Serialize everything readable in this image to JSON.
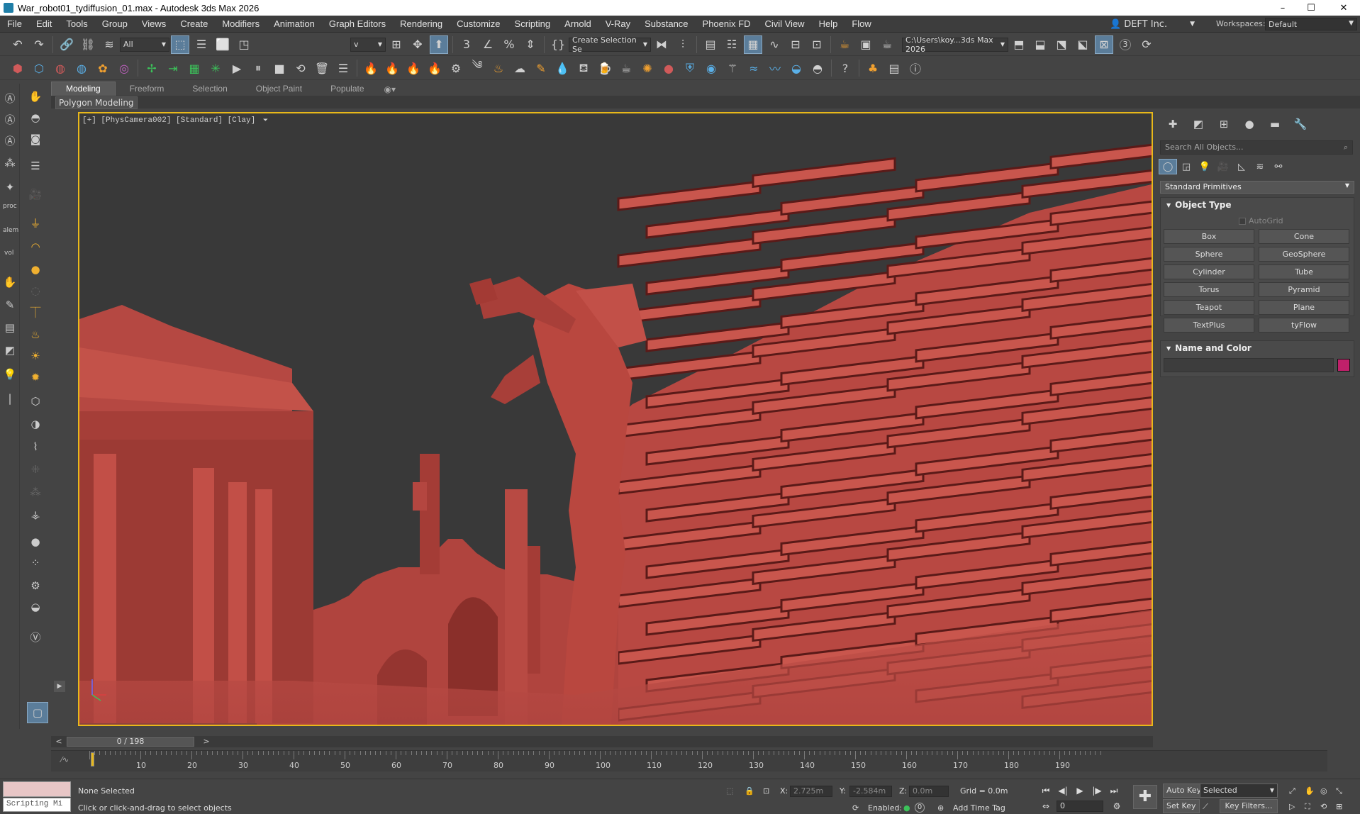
{
  "window": {
    "title": "War_robot01_tydiffusion_01.max - Autodesk 3ds Max 2026",
    "controls": [
      "–",
      "☐",
      "✕"
    ]
  },
  "menu": {
    "items": [
      "File",
      "Edit",
      "Tools",
      "Group",
      "Views",
      "Create",
      "Modifiers",
      "Animation",
      "Graph Editors",
      "Rendering",
      "Customize",
      "Scripting",
      "Arnold",
      "V-Ray",
      "Substance",
      "Phoenix FD",
      "Civil View",
      "Help",
      "Flow"
    ],
    "account": "DEFT Inc.",
    "workspaces_label": "Workspaces:",
    "workspace": "Default"
  },
  "toolbar": {
    "selection_filter": "All",
    "named_set_fragment": "v",
    "create_selection_set": "Create Selection Se",
    "project_path": "C:\\Users\\koy...3ds Max 2026",
    "percent_badge": "3"
  },
  "ribbon": {
    "tabs": [
      "Modeling",
      "Freeform",
      "Selection",
      "Object Paint",
      "Populate"
    ],
    "active_panel": "Polygon Modeling"
  },
  "left_strip": {
    "labels": [
      "proc",
      "alem",
      "vol"
    ]
  },
  "viewport": {
    "label": "[+] [PhysCamera002] [Standard] [Clay]",
    "funnel": "⏷"
  },
  "time_slider": {
    "value": "0 / 198",
    "prev": "<",
    "next": ">"
  },
  "timeline": {
    "labels": [
      "10",
      "20",
      "30",
      "40",
      "50",
      "60",
      "70",
      "80",
      "90",
      "100",
      "110",
      "120",
      "130",
      "140",
      "150",
      "160",
      "170",
      "180",
      "190"
    ]
  },
  "status": {
    "script_listener": "Scripting Mi",
    "selection": "None Selected",
    "prompt": "Click or click-and-drag to select objects",
    "x_label": "X:",
    "x": "2.725m",
    "y_label": "Y:",
    "y": "-2.584m",
    "z_label": "Z:",
    "z": "0.0m",
    "grid": "Grid = 0.0m",
    "enabled_label": "Enabled:",
    "enabled_count": "0",
    "add_time_tag": "Add Time Tag",
    "auto_key": "Auto Key",
    "set_key": "Set Key",
    "key_mode": "Selected",
    "key_filters": "Key Filters...",
    "frame": "0"
  },
  "command_panel": {
    "search_placeholder": "Search All Objects...",
    "category": "Standard Primitives",
    "object_type_title": "Object Type",
    "autogrid": "AutoGrid",
    "primitives": [
      "Box",
      "Cone",
      "Sphere",
      "GeoSphere",
      "Cylinder",
      "Tube",
      "Torus",
      "Pyramid",
      "Teapot",
      "Plane",
      "TextPlus",
      "tyFlow"
    ],
    "name_color_title": "Name and Color",
    "object_color": "#c0206a"
  },
  "colors": {
    "clay": "#c24d44",
    "viewport_border": "#e8b81a",
    "active_blue": "#5b7d9a"
  }
}
